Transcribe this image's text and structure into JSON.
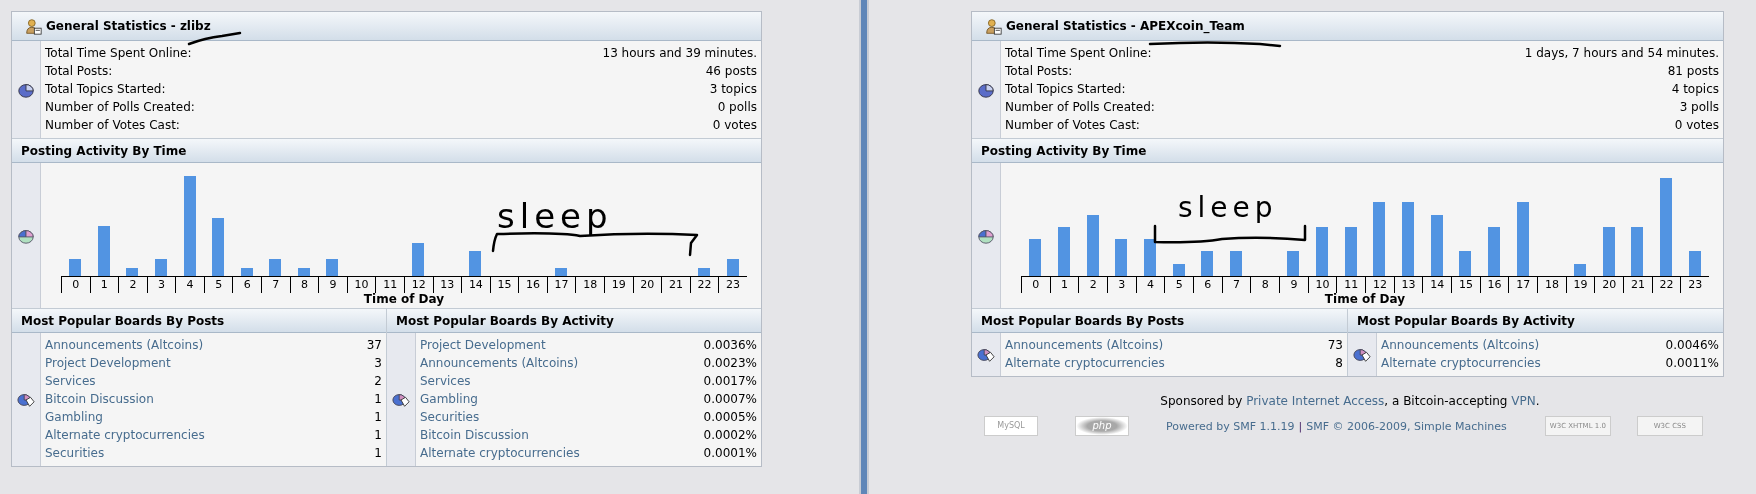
{
  "profiles": [
    {
      "title": "General Statistics - zlibz",
      "stats": [
        {
          "label": "Total Time Spent Online:",
          "value": "13 hours and 39 minutes."
        },
        {
          "label": "Total Posts:",
          "value": "46 posts"
        },
        {
          "label": "Total Topics Started:",
          "value": "3 topics"
        },
        {
          "label": "Number of Polls Created:",
          "value": "0 polls"
        },
        {
          "label": "Number of Votes Cast:",
          "value": "0 votes"
        }
      ],
      "activity": {
        "title": "Posting Activity By Time",
        "hours": [
          "0",
          "1",
          "2",
          "3",
          "4",
          "5",
          "6",
          "7",
          "8",
          "9",
          "10",
          "11",
          "12",
          "13",
          "14",
          "15",
          "16",
          "17",
          "18",
          "19",
          "20",
          "21",
          "22",
          "23"
        ],
        "xlabel": "Time of Day"
      },
      "boards_by_posts": {
        "title": "Most Popular Boards By Posts",
        "rows": [
          {
            "name": "Announcements (Altcoins)",
            "value": "37"
          },
          {
            "name": "Project Development",
            "value": "3"
          },
          {
            "name": "Services",
            "value": "2"
          },
          {
            "name": "Bitcoin Discussion",
            "value": "1"
          },
          {
            "name": "Gambling",
            "value": "1"
          },
          {
            "name": "Alternate cryptocurrencies",
            "value": "1"
          },
          {
            "name": "Securities",
            "value": "1"
          }
        ]
      },
      "boards_by_activity": {
        "title": "Most Popular Boards By Activity",
        "rows": [
          {
            "name": "Project Development",
            "value": "0.0036%"
          },
          {
            "name": "Announcements (Altcoins)",
            "value": "0.0023%"
          },
          {
            "name": "Services",
            "value": "0.0017%"
          },
          {
            "name": "Gambling",
            "value": "0.0007%"
          },
          {
            "name": "Securities",
            "value": "0.0005%"
          },
          {
            "name": "Bitcoin Discussion",
            "value": "0.0002%"
          },
          {
            "name": "Alternate cryptocurrencies",
            "value": "0.0001%"
          }
        ]
      },
      "annotations": [
        {
          "kind": "underline"
        },
        {
          "kind": "bracket"
        },
        {
          "kind": "note",
          "text": "sleep"
        }
      ]
    },
    {
      "title": "General Statistics - APEXcoin_Team",
      "stats": [
        {
          "label": "Total Time Spent Online:",
          "value": "1 days, 7 hours and 54 minutes."
        },
        {
          "label": "Total Posts:",
          "value": "81 posts"
        },
        {
          "label": "Total Topics Started:",
          "value": "4 topics"
        },
        {
          "label": "Number of Polls Created:",
          "value": "3 polls"
        },
        {
          "label": "Number of Votes Cast:",
          "value": "0 votes"
        }
      ],
      "activity": {
        "title": "Posting Activity By Time",
        "hours": [
          "0",
          "1",
          "2",
          "3",
          "4",
          "5",
          "6",
          "7",
          "8",
          "9",
          "10",
          "11",
          "12",
          "13",
          "14",
          "15",
          "16",
          "17",
          "18",
          "19",
          "20",
          "21",
          "22",
          "23"
        ],
        "xlabel": "Time of Day"
      },
      "boards_by_posts": {
        "title": "Most Popular Boards By Posts",
        "rows": [
          {
            "name": "Announcements (Altcoins)",
            "value": "73"
          },
          {
            "name": "Alternate cryptocurrencies",
            "value": "8"
          }
        ]
      },
      "boards_by_activity": {
        "title": "Most Popular Boards By Activity",
        "rows": [
          {
            "name": "Announcements (Altcoins)",
            "value": "0.0046%"
          },
          {
            "name": "Alternate cryptocurrencies",
            "value": "0.0011%"
          }
        ]
      },
      "annotations": [
        {
          "kind": "underline"
        },
        {
          "kind": "bracket"
        },
        {
          "kind": "note",
          "text": "sleep"
        }
      ],
      "footer": {
        "sponsor": [
          {
            "kind": "text",
            "text": "Sponsored by "
          },
          {
            "kind": "link",
            "text": "Private Internet Access"
          },
          {
            "kind": "text",
            "text": ", a Bitcoin-accepting "
          },
          {
            "kind": "link",
            "text": "VPN"
          },
          {
            "kind": "text",
            "text": "."
          }
        ],
        "badges": [
          {
            "kind": "mysql",
            "text": "MySQL"
          },
          {
            "kind": "php",
            "text": "php"
          }
        ],
        "powered": [
          {
            "kind": "link",
            "text": "Powered by SMF 1.1.19"
          },
          {
            "kind": "separator",
            "text": "|"
          },
          {
            "kind": "link",
            "text": "SMF © 2006-2009, Simple Machines"
          }
        ],
        "badges_right": [
          {
            "kind": "w3c",
            "text": "W3C XHTML 1.0"
          },
          {
            "kind": "w3c",
            "text": "W3C CSS"
          }
        ]
      }
    }
  ]
}
